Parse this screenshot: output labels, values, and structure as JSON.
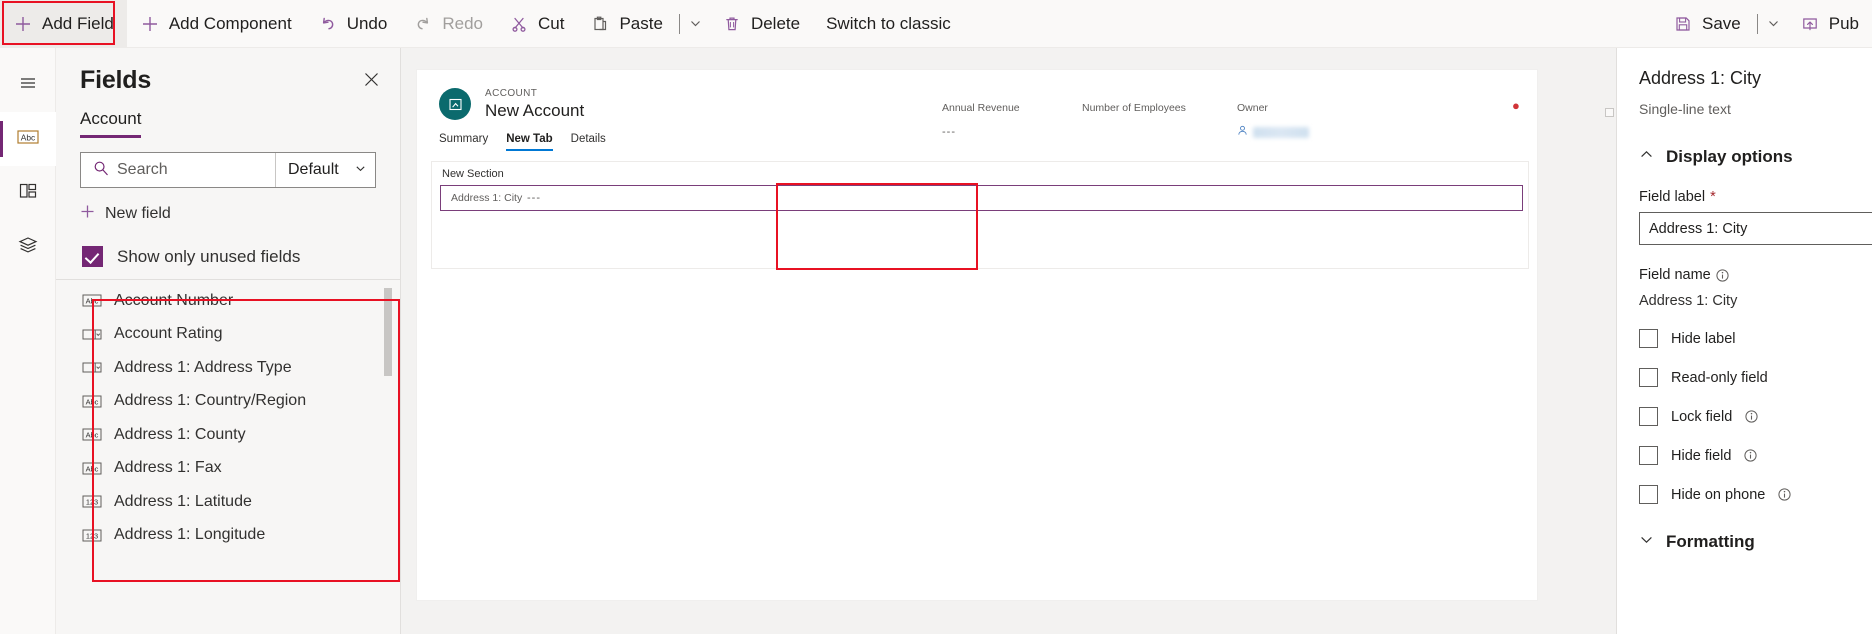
{
  "commandbar": {
    "items": [
      {
        "label": "Add Field",
        "icon": "plus-icon",
        "state": "active"
      },
      {
        "label": "Add Component",
        "icon": "plus-icon",
        "state": "normal"
      },
      {
        "label": "Undo",
        "icon": "undo-icon",
        "state": "normal"
      },
      {
        "label": "Redo",
        "icon": "redo-icon",
        "state": "disabled"
      },
      {
        "label": "Cut",
        "icon": "scissors-icon",
        "state": "normal"
      },
      {
        "label": "Paste",
        "icon": "clipboard-icon",
        "state": "normal"
      },
      {
        "label": "Delete",
        "icon": "trash-icon",
        "state": "normal"
      },
      {
        "label": "Switch to classic",
        "icon": "none",
        "state": "normal"
      }
    ],
    "save_label": "Save",
    "publish_label": "Pub"
  },
  "rail": {
    "items": [
      {
        "name": "hamburger",
        "icon": "hamburger-icon"
      },
      {
        "name": "fields",
        "icon": "abc-icon"
      },
      {
        "name": "components",
        "icon": "components-icon"
      },
      {
        "name": "layers",
        "icon": "layers-icon"
      }
    ]
  },
  "fields_panel": {
    "title": "Fields",
    "tab": "Account",
    "search_placeholder": "Search",
    "search_value": "",
    "filter_value": "Default",
    "new_field_label": "New field",
    "show_unused_label": "Show only unused fields",
    "show_unused_checked": true,
    "items": [
      {
        "label": "Account Number",
        "type": "text"
      },
      {
        "label": "Account Rating",
        "type": "choice"
      },
      {
        "label": "Address 1: Address Type",
        "type": "choice"
      },
      {
        "label": "Address 1: Country/Region",
        "type": "text"
      },
      {
        "label": "Address 1: County",
        "type": "text"
      },
      {
        "label": "Address 1: Fax",
        "type": "text"
      },
      {
        "label": "Address 1: Latitude",
        "type": "number"
      },
      {
        "label": "Address 1: Longitude",
        "type": "number"
      }
    ]
  },
  "form": {
    "record_kicker": "ACCOUNT",
    "record_title": "New Account",
    "header_fields": [
      {
        "label": "Annual Revenue",
        "value": "---"
      },
      {
        "label": "Number of Employees",
        "value": "---"
      },
      {
        "label": "Owner",
        "value": ""
      }
    ],
    "tabs": [
      {
        "label": "Summary",
        "active": false
      },
      {
        "label": "New Tab",
        "active": true
      },
      {
        "label": "Details",
        "active": false
      }
    ],
    "section_title": "New Section",
    "field_label": "Address 1: City",
    "field_value": "---"
  },
  "properties": {
    "title": "Address 1: City",
    "subtitle": "Single-line text",
    "display_options_label": "Display options",
    "field_label_label": "Field label",
    "field_label_required": "*",
    "field_label_value": "Address 1: City",
    "field_name_label": "Field name",
    "field_name_value": "Address 1: City",
    "checkboxes": [
      {
        "label": "Hide label",
        "info": false,
        "checked": false
      },
      {
        "label": "Read-only field",
        "info": false,
        "checked": false
      },
      {
        "label": "Lock field",
        "info": true,
        "checked": false
      },
      {
        "label": "Hide field",
        "info": true,
        "checked": false
      },
      {
        "label": "Hide on phone",
        "info": true,
        "checked": false
      }
    ],
    "formatting_label": "Formatting"
  },
  "colors": {
    "accent": "#742774",
    "highlight": "#e81123",
    "tab_active": "#0078d4",
    "avatar": "#0b6a6d"
  }
}
